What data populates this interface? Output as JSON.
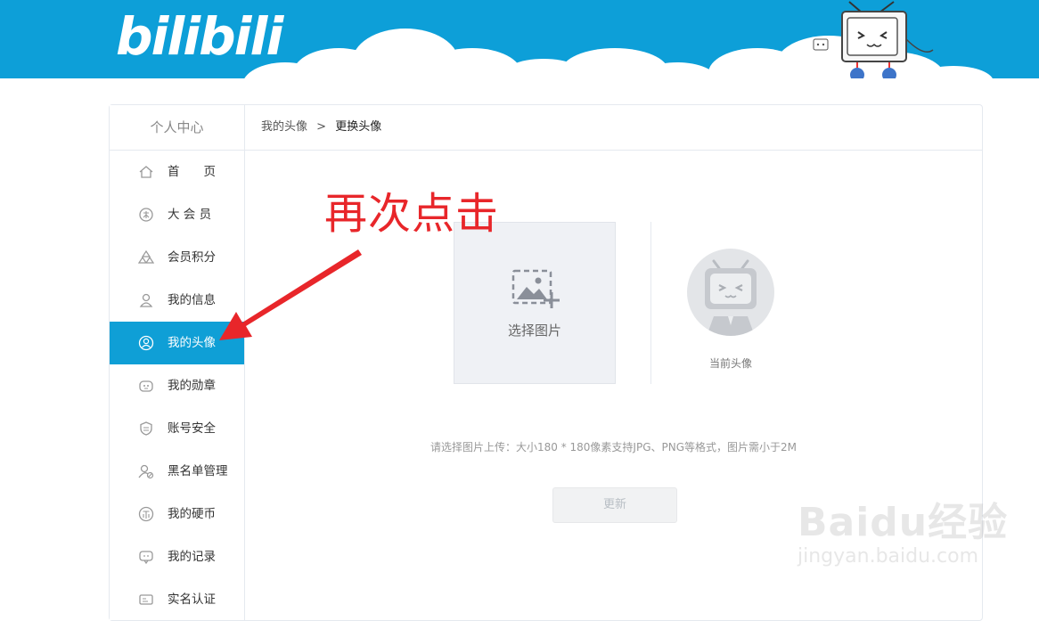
{
  "brand": {
    "logo_text": "bilibili"
  },
  "sidebar": {
    "title": "个人中心",
    "items": [
      {
        "label": "首　　页",
        "icon": "home-icon"
      },
      {
        "label": "大 会 员",
        "icon": "vip-icon"
      },
      {
        "label": "会员积分",
        "icon": "points-icon"
      },
      {
        "label": "我的信息",
        "icon": "user-icon"
      },
      {
        "label": "我的头像",
        "icon": "avatar-icon",
        "active": true
      },
      {
        "label": "我的勋章",
        "icon": "medal-icon"
      },
      {
        "label": "账号安全",
        "icon": "shield-icon"
      },
      {
        "label": "黑名单管理",
        "icon": "blacklist-icon"
      },
      {
        "label": "我的硬币",
        "icon": "coin-icon"
      },
      {
        "label": "我的记录",
        "icon": "record-icon"
      },
      {
        "label": "实名认证",
        "icon": "id-card-icon"
      }
    ]
  },
  "breadcrumb": {
    "parent": "我的头像",
    "separator": ">",
    "current": "更换头像"
  },
  "upload": {
    "label": "选择图片",
    "icon": "image-add-icon"
  },
  "current_avatar": {
    "label": "当前头像"
  },
  "hint": "请选择图片上传：大小180 * 180像素支持JPG、PNG等格式，图片需小于2M",
  "update_button": {
    "label": "更新",
    "state": "disabled"
  },
  "annotation": {
    "text": "再次点击",
    "color": "#e8262a"
  },
  "watermark": {
    "brand": "Baidu经验",
    "url": "jingyan.baidu.com"
  },
  "colors": {
    "header": "#0d9fd8",
    "active_item": "#0f9fd6"
  }
}
